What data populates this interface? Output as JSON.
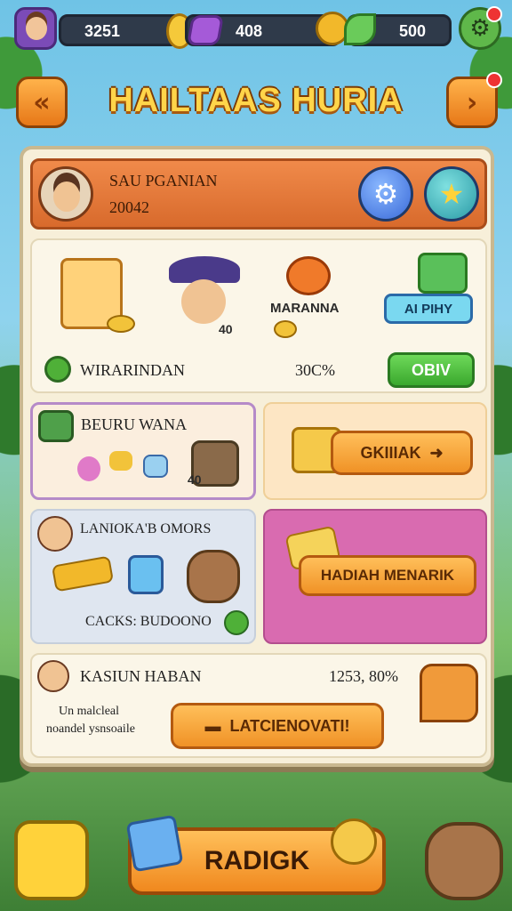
{
  "resources": {
    "gold": "3251",
    "gems": "408",
    "leaves": "500"
  },
  "header": {
    "title": "HAILTAAS HURIA"
  },
  "profile": {
    "name": "SAU PGANIAN",
    "score": "20042"
  },
  "rewards": {
    "item_labels": [
      "40",
      "MARANNA",
      "AI PIHY"
    ],
    "status_text": "WIRARINDAN",
    "percent": "30C%",
    "button_label": "OBIV"
  },
  "cards": {
    "bundle_title": "BEURU WANA",
    "bundle_badge": "40",
    "offer_button": "GKIIIAK",
    "bonus_title": "LANIOKA'B OMORS",
    "bonus_footer": "CACKS: BUDOONO",
    "hadiah_button": "HADIAH MENARIK"
  },
  "progress": {
    "title": "KASIUN HABAN",
    "value": "1253, 80%",
    "desc_line1": "Un malcleal",
    "desc_line2": "noandel ysnsoaile",
    "button_label": "LATCIENOVATI!"
  },
  "footer": {
    "main_button": "RADIGK"
  },
  "colors": {
    "accent_orange": "#f09226",
    "panel_bg": "#f7efd9",
    "pink_card": "#d96bb0",
    "green_button": "#3aa82d"
  }
}
